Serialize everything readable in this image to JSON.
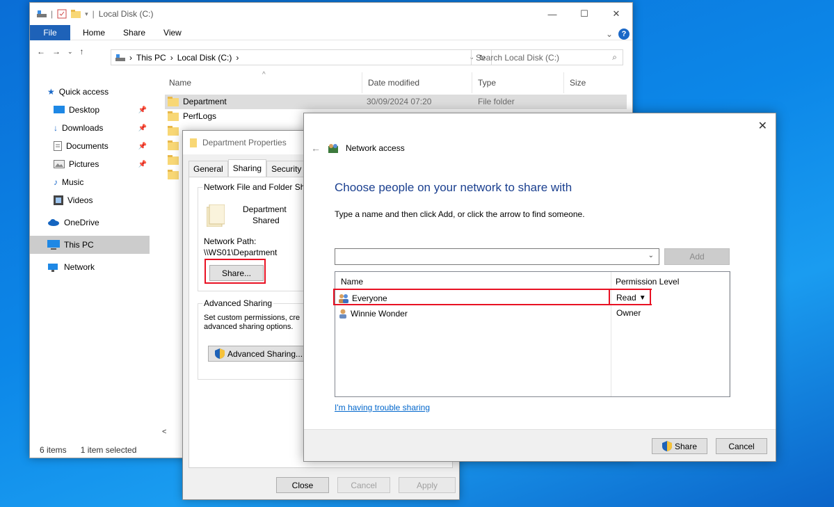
{
  "explorer": {
    "title": "Local Disk (C:)",
    "ribbon_tabs": [
      "File",
      "Home",
      "Share",
      "View"
    ],
    "breadcrumb": [
      "This PC",
      "Local Disk (C:)"
    ],
    "search_placeholder": "Search Local Disk (C:)",
    "nav": {
      "quick_access": "Quick access",
      "desktop": "Desktop",
      "downloads": "Downloads",
      "documents": "Documents",
      "pictures": "Pictures",
      "music": "Music",
      "videos": "Videos",
      "onedrive": "OneDrive",
      "this_pc": "This PC",
      "network": "Network"
    },
    "columns": {
      "name": "Name",
      "date": "Date modified",
      "type": "Type",
      "size": "Size"
    },
    "rows": [
      {
        "name": "Department",
        "date": "30/09/2024 07:20",
        "type": "File folder"
      },
      {
        "name": "PerfLogs"
      }
    ],
    "status_items": "6 items",
    "status_selected": "1 item selected"
  },
  "properties": {
    "title": "Department Properties",
    "tabs": [
      "General",
      "Sharing",
      "Security"
    ],
    "nffs_title": "Network File and Folder Sh",
    "folder_name": "Department",
    "folder_state": "Shared",
    "network_path_label": "Network Path:",
    "network_path": "\\\\WS01\\Department",
    "share_button": "Share...",
    "adv_title": "Advanced Sharing",
    "adv_desc_1": "Set custom permissions, cre",
    "adv_desc_2": "advanced sharing options.",
    "adv_button": "Advanced Sharing...",
    "close": "Close",
    "cancel": "Cancel",
    "apply": "Apply"
  },
  "network_access": {
    "title": "Network access",
    "heading": "Choose people on your network to share with",
    "instruction": "Type a name and then click Add, or click the arrow to find someone.",
    "add_button": "Add",
    "col_name": "Name",
    "col_perm": "Permission Level",
    "users": [
      {
        "name": "Everyone",
        "perm": "Read"
      },
      {
        "name": "Winnie Wonder",
        "perm": "Owner"
      }
    ],
    "trouble_link": "I'm having trouble sharing",
    "share_button": "Share",
    "cancel_button": "Cancel"
  },
  "colors": {
    "desktop": "#0c87e8",
    "file_tab": "#1e62b8",
    "highlight": "#e81123",
    "heading": "#1a3f8f",
    "link": "#0066cc"
  }
}
